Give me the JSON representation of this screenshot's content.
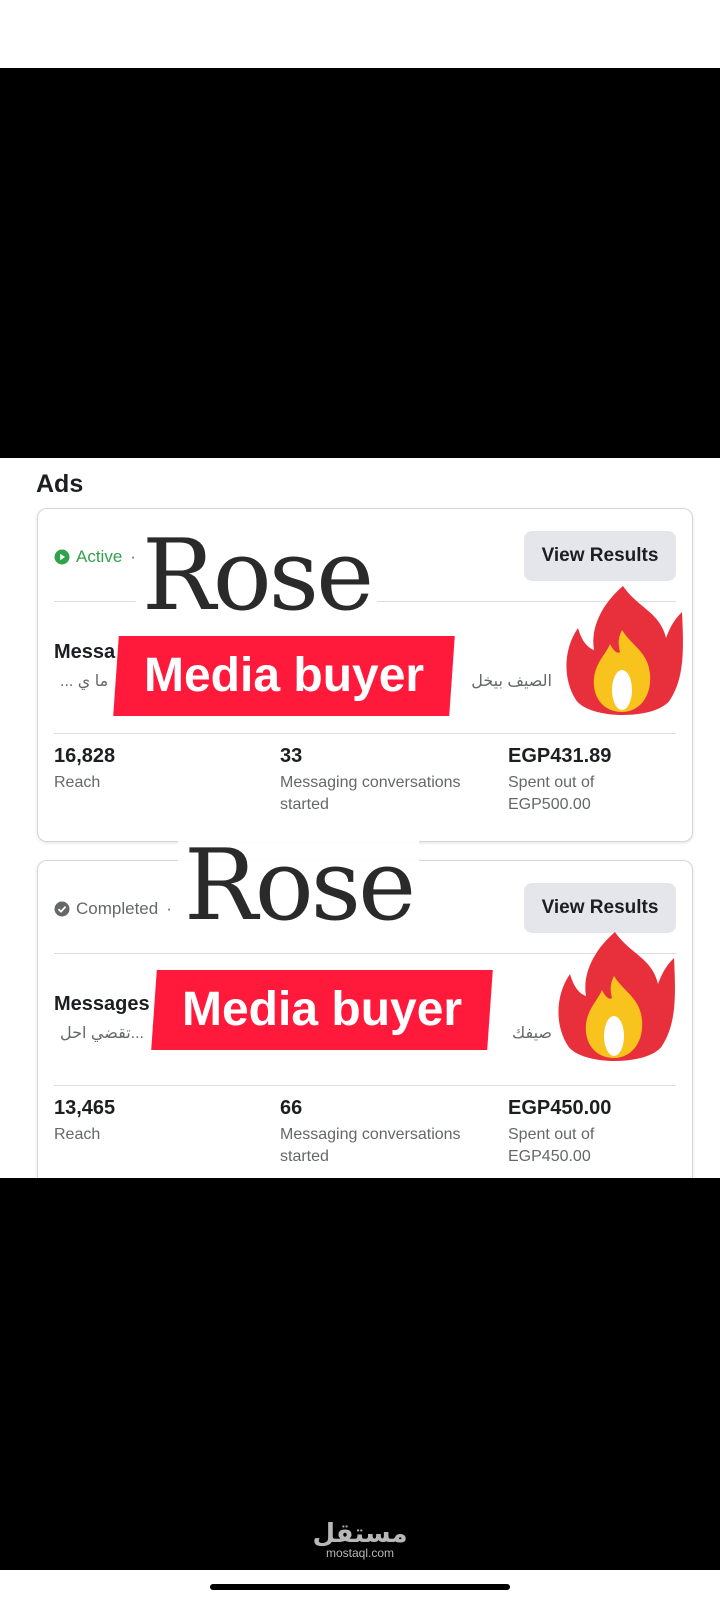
{
  "section": {
    "heading": "Ads"
  },
  "cards": [
    {
      "status": "Active",
      "button": "View Results",
      "title_partial": "Messa",
      "body_partial": "... ما ي",
      "body_arabic": "الصيف بيخل",
      "stats": [
        {
          "value": "16,828",
          "label": "Reach"
        },
        {
          "value": "33",
          "label": "Messaging conversations started"
        },
        {
          "value": "EGP431.89",
          "label": "Spent out of EGP500.00"
        }
      ]
    },
    {
      "status": "Completed",
      "button": "View Results",
      "title_partial": "Messages",
      "body_partial": "تقضي احل...",
      "body_arabic": "صيفك",
      "stats": [
        {
          "value": "13,465",
          "label": "Reach"
        },
        {
          "value": "66",
          "label": "Messaging conversations started"
        },
        {
          "value": "EGP450.00",
          "label": "Spent out of EGP450.00"
        }
      ]
    }
  ],
  "overlay": {
    "brand": "Rose",
    "tagline": "Media buyer"
  },
  "watermark": {
    "arabic": "مستقل",
    "latin": "mostaql.com"
  },
  "colors": {
    "active": "#31a24c",
    "banner": "#ff1a3c",
    "button_bg": "#e4e6eb"
  },
  "icons": [
    "play-circle-icon",
    "check-circle-icon",
    "fire-emoji-icon"
  ]
}
